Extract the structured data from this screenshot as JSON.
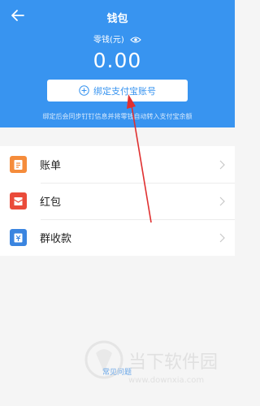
{
  "header": {
    "title": "钱包",
    "balance_label": "零钱(元)",
    "balance": "0.00",
    "bind_button_label": "绑定支付宝账号",
    "hint": "绑定后会同步钉钉信息并将零钱自动转入支付宝余额"
  },
  "menu": {
    "items": [
      {
        "label": "账单",
        "icon": "bill-icon",
        "color": "#f58c3b"
      },
      {
        "label": "红包",
        "icon": "red-envelope-icon",
        "color": "#ea4b3a"
      },
      {
        "label": "群收款",
        "icon": "group-collect-icon",
        "color": "#3a85e0"
      }
    ]
  },
  "footer": {
    "faq_label": "常见问题"
  },
  "watermark": {
    "text": "当下软件园",
    "url": "www.downxia.com"
  },
  "colors": {
    "primary": "#3894f0",
    "arrow": "#e03030"
  }
}
